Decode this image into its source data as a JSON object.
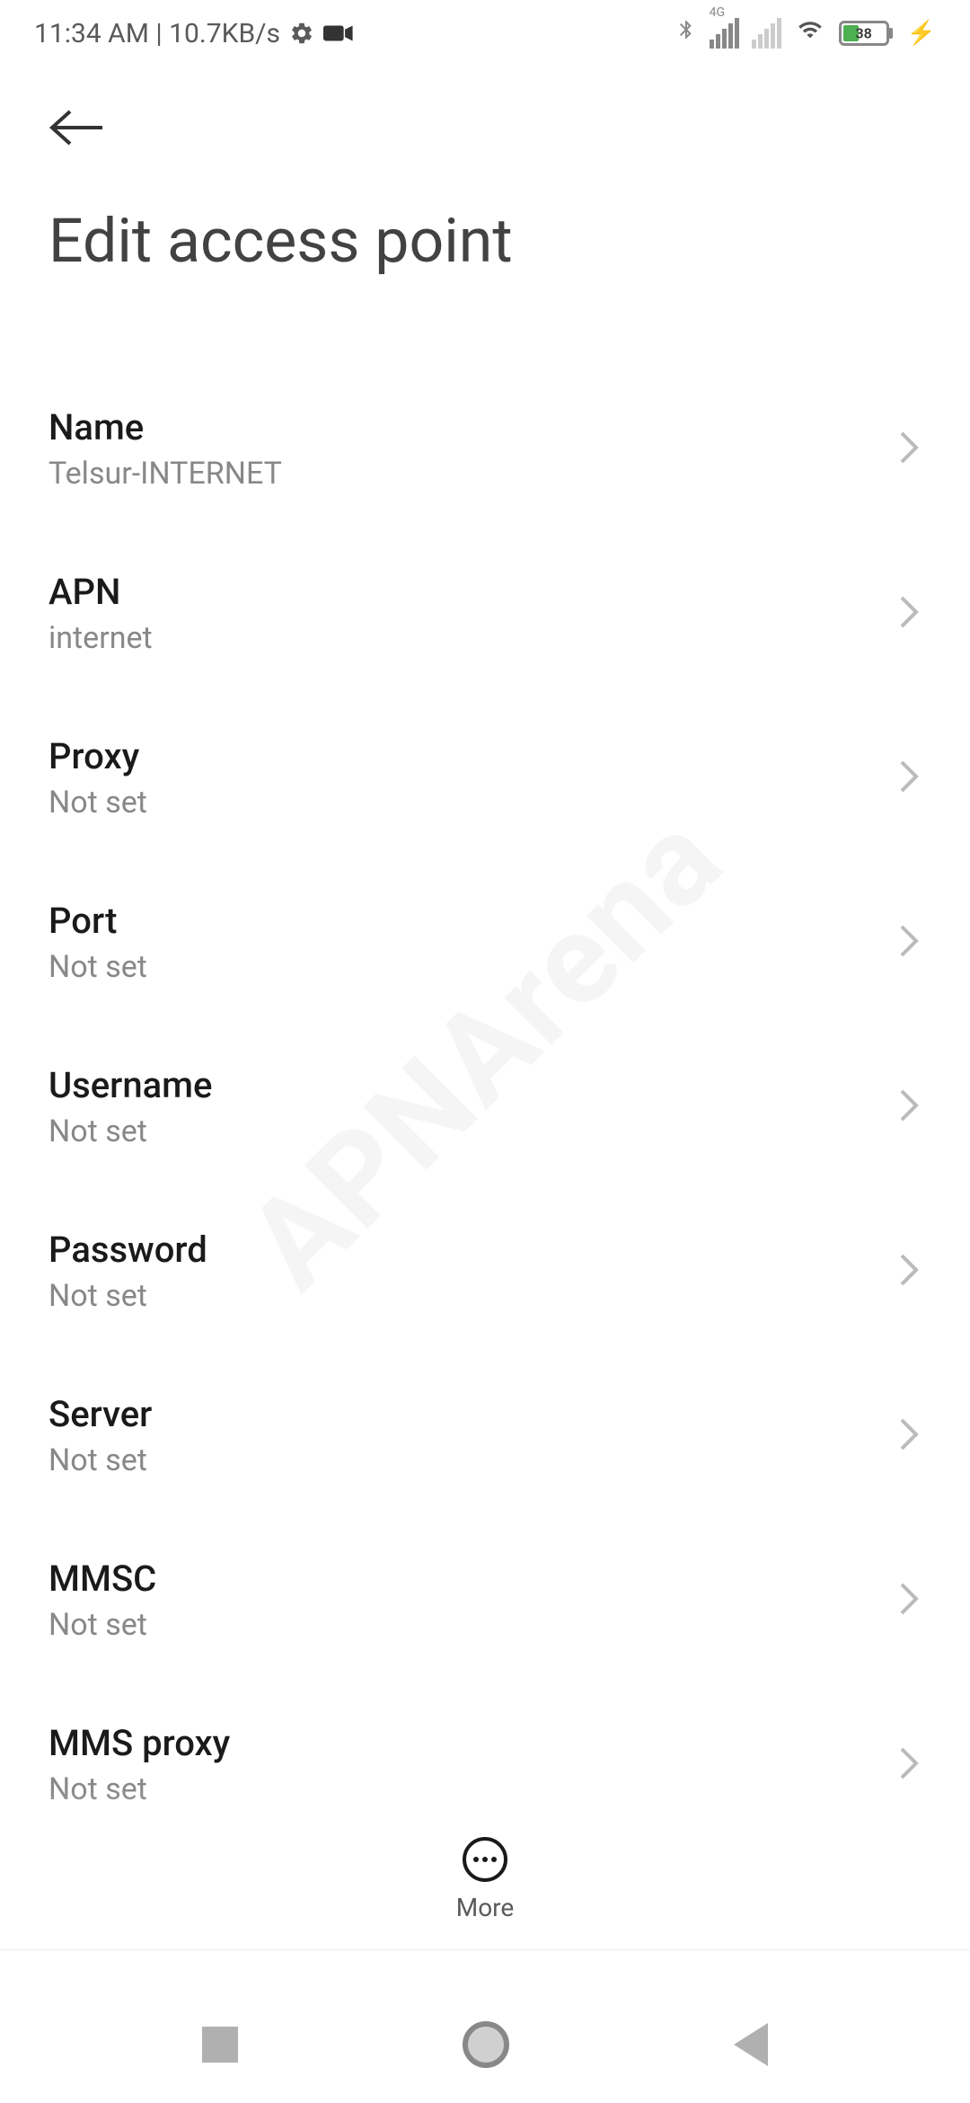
{
  "status": {
    "time": "11:34 AM",
    "data_rate": "10.7KB/s",
    "battery_pct": 38,
    "network_type": "4G"
  },
  "header": {
    "title": "Edit access point"
  },
  "bottom_action": {
    "label": "More"
  },
  "settings": [
    {
      "label": "Name",
      "value": "Telsur-INTERNET"
    },
    {
      "label": "APN",
      "value": "internet"
    },
    {
      "label": "Proxy",
      "value": "Not set"
    },
    {
      "label": "Port",
      "value": "Not set"
    },
    {
      "label": "Username",
      "value": "Not set"
    },
    {
      "label": "Password",
      "value": "Not set"
    },
    {
      "label": "Server",
      "value": "Not set"
    },
    {
      "label": "MMSC",
      "value": "Not set"
    },
    {
      "label": "MMS proxy",
      "value": "Not set"
    }
  ],
  "watermark": "APNArena"
}
